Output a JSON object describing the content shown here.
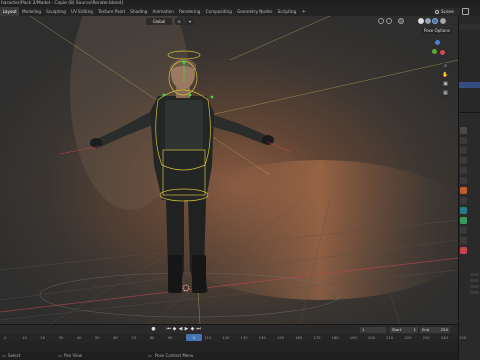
{
  "window": {
    "title": "haracter/Pack 2/Model - Copie (8) Source\\Render.blend]"
  },
  "workspace_tabs": [
    {
      "label": "Layout",
      "active": true
    },
    {
      "label": "Modeling",
      "active": false
    },
    {
      "label": "Sculpting",
      "active": false
    },
    {
      "label": "UV Editing",
      "active": false
    },
    {
      "label": "Texture Paint",
      "active": false
    },
    {
      "label": "Shading",
      "active": false
    },
    {
      "label": "Animation",
      "active": false
    },
    {
      "label": "Rendering",
      "active": false
    },
    {
      "label": "Compositing",
      "active": false
    },
    {
      "label": "Geometry Nodes",
      "active": false
    },
    {
      "label": "Scripting",
      "active": false
    }
  ],
  "add_tab_label": "+",
  "scene": {
    "label": "Scene"
  },
  "viewport": {
    "orientation_label": "Global",
    "pose_options_label": "Pose Options",
    "accent_color": "#4772b3",
    "rig_color": "#d6c13a",
    "bone_select_color": "#3fd64a"
  },
  "timeline": {
    "current_frame": "1",
    "start_label": "Start",
    "start_value": "1",
    "end_label": "End",
    "end_value": "250",
    "ruler_ticks": [
      "0",
      "10",
      "20",
      "30",
      "40",
      "50",
      "60",
      "70",
      "80",
      "90",
      "100",
      "110",
      "120",
      "130",
      "140",
      "150",
      "160",
      "170",
      "180",
      "190",
      "200",
      "210",
      "220",
      "230",
      "240",
      "250"
    ],
    "playhead_label": "1"
  },
  "statusbar": {
    "select_label": "Select",
    "pan_label": "Pan View",
    "context_label": "Pose Context Menu"
  }
}
